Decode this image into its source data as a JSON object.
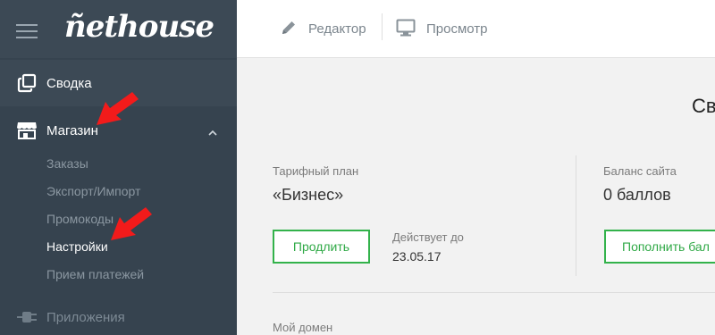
{
  "sidebar": {
    "logo": "ñethouse",
    "items": [
      {
        "label": "Сводка",
        "icon": "copy-icon"
      },
      {
        "label": "Магазин",
        "icon": "store-icon"
      },
      {
        "label": "Приложения",
        "icon": "plug-icon"
      }
    ],
    "submenu": [
      "Заказы",
      "Экспорт/Импорт",
      "Промокоды",
      "Настройки",
      "Прием платежей"
    ]
  },
  "topbar": {
    "editor_label": "Редактор",
    "preview_label": "Просмотр"
  },
  "main": {
    "heading": "Св",
    "tariff": {
      "label": "Тарифный план",
      "value": "«Бизнес»",
      "renew_button": "Продлить",
      "valid_label": "Действует до",
      "valid_date": "23.05.17"
    },
    "balance": {
      "label": "Баланс сайта",
      "value": "0 баллов",
      "topup_button": "Пополнить бал"
    },
    "domain_label": "Мой домен"
  },
  "colors": {
    "sidebar_bg": "#36434f",
    "accent_green": "#33b24b",
    "annotation_arrow": "#f21b1b"
  }
}
